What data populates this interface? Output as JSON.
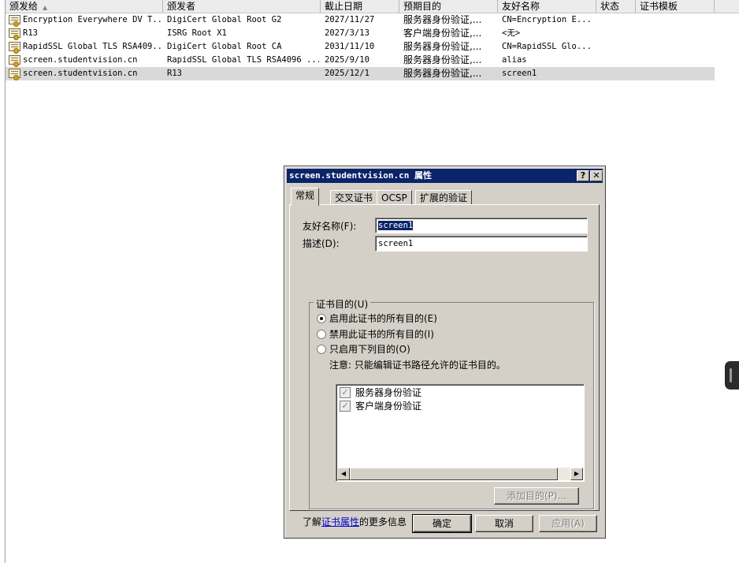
{
  "list": {
    "columns": [
      "颁发给",
      "颁发者",
      "截止日期",
      "预期目的",
      "友好名称",
      "状态",
      "证书模板"
    ],
    "sort_indicator": "▲",
    "rows": [
      {
        "issued_to": "Encryption Everywhere DV T...",
        "issued_by": "DigiCert Global Root G2",
        "expires": "2027/11/27",
        "purposes": "服务器身份验证,...",
        "friendly_name": "CN=Encryption E...",
        "status": "",
        "template": "",
        "selected": false
      },
      {
        "issued_to": "R13",
        "issued_by": "ISRG Root X1",
        "expires": "2027/3/13",
        "purposes": "客户端身份验证,...",
        "friendly_name": "<无>",
        "status": "",
        "template": "",
        "selected": false
      },
      {
        "issued_to": "RapidSSL Global TLS RSA409...",
        "issued_by": "DigiCert Global Root CA",
        "expires": "2031/11/10",
        "purposes": "服务器身份验证,...",
        "friendly_name": "CN=RapidSSL Glo...",
        "status": "",
        "template": "",
        "selected": false
      },
      {
        "issued_to": "screen.studentvision.cn",
        "issued_by": "RapidSSL Global TLS RSA4096 ...",
        "expires": "2025/9/10",
        "purposes": "服务器身份验证,...",
        "friendly_name": "alias",
        "status": "",
        "template": "",
        "selected": false
      },
      {
        "issued_to": "screen.studentvision.cn",
        "issued_by": "R13",
        "expires": "2025/12/1",
        "purposes": "服务器身份验证,...",
        "friendly_name": "screen1",
        "status": "",
        "template": "",
        "selected": true
      }
    ]
  },
  "dialog": {
    "title_host": "screen.studentvision.cn",
    "title_suffix": "属性",
    "help_glyph": "?",
    "close_glyph": "✕",
    "tabs": [
      "常规",
      "交叉证书",
      "OCSP",
      "扩展的验证"
    ],
    "active_tab": 0,
    "friendly_name_label": "友好名称(F):",
    "friendly_name_value": "screen1",
    "description_label": "描述(D):",
    "description_value": "screen1",
    "group_title": "证书目的(U)",
    "radio_options": [
      {
        "label": "启用此证书的所有目的(E)",
        "checked": true
      },
      {
        "label": "禁用此证书的所有目的(I)",
        "checked": false
      },
      {
        "label": "只启用下列目的(O)",
        "checked": false
      }
    ],
    "note": "注意: 只能编辑证书路径允许的证书目的。",
    "purposes": [
      {
        "label": "服务器身份验证",
        "checked": true
      },
      {
        "label": "客户端身份验证",
        "checked": true
      }
    ],
    "add_purpose_label": "添加目的(P)...",
    "learn_more_prefix": "了解",
    "learn_more_link": "证书属性",
    "learn_more_suffix": "的更多信息",
    "ok_label": "确定",
    "cancel_label": "取消",
    "apply_label": "应用(A)"
  }
}
